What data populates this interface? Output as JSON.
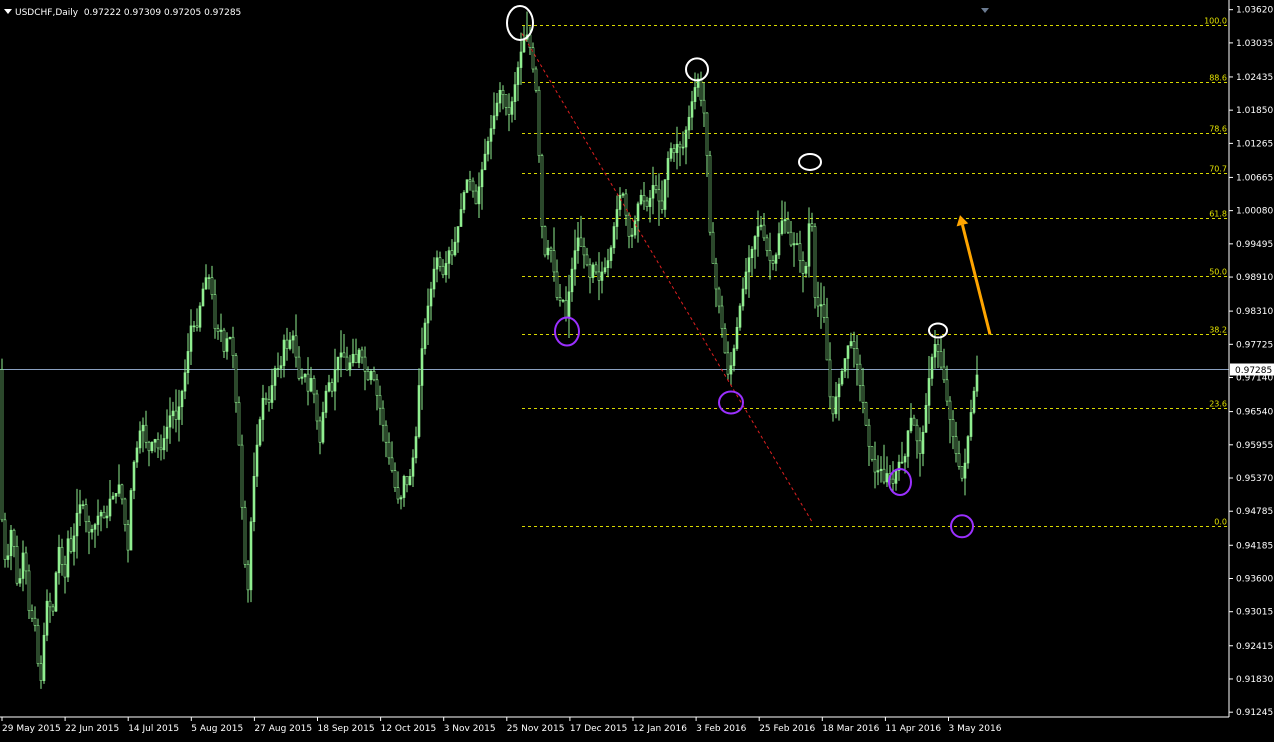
{
  "header": {
    "symbol": "USDCHF,Daily",
    "ohlc": "0.97222 0.97309 0.97205 0.97285"
  },
  "colors": {
    "background": "#000000",
    "candle": "#90ee90",
    "fib_line": "#d8d800",
    "fib_label": "#e0e000",
    "trend_line": "#e02020",
    "arrow": "#ffa500",
    "high_marker": "#ffffff",
    "low_marker": "#9b30ff",
    "axis_text": "#ffffff",
    "price_line": "#8aa0c0"
  },
  "chart_data": {
    "type": "candlestick",
    "symbol": "USDCHF",
    "timeframe": "Daily",
    "x_labels": [
      "29 May 2015",
      "22 Jun 2015",
      "14 Jul 2015",
      "5 Aug 2015",
      "27 Aug 2015",
      "18 Sep 2015",
      "12 Oct 2015",
      "3 Nov 2015",
      "25 Nov 2015",
      "17 Dec 2015",
      "12 Jan 2016",
      "3 Feb 2016",
      "25 Feb 2016",
      "18 Mar 2016",
      "11 Apr 2016",
      "3 May 2016"
    ],
    "y_ticks": [
      "1.03620",
      "1.03035",
      "1.02435",
      "1.01850",
      "1.01265",
      "1.00665",
      "1.00080",
      "0.99495",
      "0.98910",
      "0.98310",
      "0.97725",
      "0.97140",
      "0.96540",
      "0.95955",
      "0.95370",
      "0.94785",
      "0.94185",
      "0.93600",
      "0.93015",
      "0.92415",
      "0.91830",
      "0.91245"
    ],
    "y_range": [
      0.9116,
      1.0372
    ],
    "current_price": "0.97285",
    "price_path": [
      [
        0,
        0.951
      ],
      [
        6,
        0.937
      ],
      [
        12,
        0.946
      ],
      [
        18,
        0.933
      ],
      [
        24,
        0.942
      ],
      [
        30,
        0.928
      ],
      [
        34,
        0.93
      ],
      [
        38,
        0.921
      ],
      [
        41,
        0.918
      ],
      [
        44,
        0.926
      ],
      [
        48,
        0.934
      ],
      [
        52,
        0.928
      ],
      [
        56,
        0.937
      ],
      [
        60,
        0.943
      ],
      [
        64,
        0.934
      ],
      [
        68,
        0.943
      ],
      [
        72,
        0.94
      ],
      [
        76,
        0.947
      ],
      [
        82,
        0.95
      ],
      [
        88,
        0.944
      ],
      [
        94,
        0.945
      ],
      [
        100,
        0.948
      ],
      [
        106,
        0.946
      ],
      [
        110,
        0.95
      ],
      [
        116,
        0.951
      ],
      [
        120,
        0.953
      ],
      [
        124,
        0.947
      ],
      [
        128,
        0.941
      ],
      [
        132,
        0.955
      ],
      [
        136,
        0.958
      ],
      [
        142,
        0.964
      ],
      [
        148,
        0.958
      ],
      [
        154,
        0.961
      ],
      [
        160,
        0.958
      ],
      [
        166,
        0.962
      ],
      [
        172,
        0.966
      ],
      [
        176,
        0.964
      ],
      [
        180,
        0.967
      ],
      [
        184,
        0.971
      ],
      [
        188,
        0.976
      ],
      [
        192,
        0.982
      ],
      [
        196,
        0.979
      ],
      [
        200,
        0.984
      ],
      [
        204,
        0.988
      ],
      [
        208,
        0.99
      ],
      [
        212,
        0.986
      ],
      [
        216,
        0.978
      ],
      [
        220,
        0.981
      ],
      [
        224,
        0.976
      ],
      [
        228,
        0.979
      ],
      [
        232,
        0.978
      ],
      [
        236,
        0.967
      ],
      [
        240,
        0.957
      ],
      [
        244,
        0.94
      ],
      [
        248,
        0.934
      ],
      [
        252,
        0.95
      ],
      [
        256,
        0.958
      ],
      [
        260,
        0.964
      ],
      [
        264,
        0.969
      ],
      [
        268,
        0.966
      ],
      [
        272,
        0.97
      ],
      [
        276,
        0.974
      ],
      [
        280,
        0.972
      ],
      [
        284,
        0.978
      ],
      [
        288,
        0.976
      ],
      [
        292,
        0.98
      ],
      [
        296,
        0.975
      ],
      [
        300,
        0.97
      ],
      [
        304,
        0.973
      ],
      [
        308,
        0.969
      ],
      [
        312,
        0.972
      ],
      [
        316,
        0.965
      ],
      [
        320,
        0.96
      ],
      [
        324,
        0.967
      ],
      [
        328,
        0.971
      ],
      [
        332,
        0.969
      ],
      [
        336,
        0.974
      ],
      [
        340,
        0.976
      ],
      [
        344,
        0.975
      ],
      [
        348,
        0.972
      ],
      [
        352,
        0.976
      ],
      [
        356,
        0.974
      ],
      [
        360,
        0.977
      ],
      [
        364,
        0.973
      ],
      [
        368,
        0.971
      ],
      [
        372,
        0.973
      ],
      [
        376,
        0.969
      ],
      [
        380,
        0.966
      ],
      [
        384,
        0.962
      ],
      [
        388,
        0.958
      ],
      [
        392,
        0.955
      ],
      [
        396,
        0.951
      ],
      [
        400,
        0.949
      ],
      [
        404,
        0.954
      ],
      [
        408,
        0.952
      ],
      [
        412,
        0.956
      ],
      [
        416,
        0.961
      ],
      [
        420,
        0.973
      ],
      [
        424,
        0.98
      ],
      [
        428,
        0.984
      ],
      [
        432,
        0.988
      ],
      [
        436,
        0.993
      ],
      [
        440,
        0.991
      ],
      [
        444,
        0.989
      ],
      [
        448,
        0.994
      ],
      [
        452,
        0.993
      ],
      [
        456,
        0.996
      ],
      [
        460,
        1.0
      ],
      [
        464,
        1.004
      ],
      [
        468,
        1.007
      ],
      [
        472,
        1.005
      ],
      [
        476,
        1.002
      ],
      [
        480,
        1.006
      ],
      [
        484,
        1.01
      ],
      [
        488,
        1.013
      ],
      [
        492,
        1.016
      ],
      [
        496,
        1.019
      ],
      [
        500,
        1.022
      ],
      [
        504,
        1.021
      ],
      [
        508,
        1.017
      ],
      [
        512,
        1.02
      ],
      [
        516,
        1.024
      ],
      [
        520,
        1.028
      ],
      [
        524,
        1.031
      ],
      [
        528,
        1.032
      ],
      [
        532,
        1.027
      ],
      [
        536,
        1.022
      ],
      [
        538,
        1.015
      ],
      [
        540,
        1.006
      ],
      [
        542,
        0.998
      ],
      [
        545,
        0.993
      ],
      [
        550,
        0.995
      ],
      [
        554,
        0.99
      ],
      [
        558,
        0.984
      ],
      [
        562,
        0.986
      ],
      [
        566,
        0.982
      ],
      [
        570,
        0.988
      ],
      [
        574,
        0.993
      ],
      [
        578,
        0.996
      ],
      [
        582,
        0.994
      ],
      [
        586,
        0.992
      ],
      [
        590,
        0.989
      ],
      [
        594,
        0.992
      ],
      [
        598,
        0.988
      ],
      [
        602,
        0.99
      ],
      [
        606,
        0.991
      ],
      [
        610,
        0.993
      ],
      [
        614,
        0.998
      ],
      [
        618,
        1.002
      ],
      [
        622,
        1.005
      ],
      [
        626,
        1.0
      ],
      [
        630,
        0.995
      ],
      [
        634,
        0.998
      ],
      [
        638,
        1.002
      ],
      [
        642,
        1.004
      ],
      [
        646,
        1.001
      ],
      [
        650,
        1.003
      ],
      [
        654,
        1.006
      ],
      [
        658,
        1.003
      ],
      [
        662,
        1.001
      ],
      [
        666,
        1.008
      ],
      [
        670,
        1.012
      ],
      [
        674,
        1.011
      ],
      [
        678,
        1.013
      ],
      [
        682,
        1.011
      ],
      [
        686,
        1.015
      ],
      [
        690,
        1.018
      ],
      [
        694,
        1.022
      ],
      [
        698,
        1.024
      ],
      [
        702,
        1.019
      ],
      [
        706,
        1.017
      ],
      [
        708,
        1.004
      ],
      [
        710,
        0.997
      ],
      [
        712,
        0.99
      ],
      [
        714,
        0.993
      ],
      [
        716,
        0.987
      ],
      [
        720,
        0.983
      ],
      [
        724,
        0.977
      ],
      [
        728,
        0.972
      ],
      [
        732,
        0.974
      ],
      [
        736,
        0.979
      ],
      [
        740,
        0.984
      ],
      [
        744,
        0.988
      ],
      [
        748,
        0.992
      ],
      [
        752,
        0.994
      ],
      [
        756,
        0.997
      ],
      [
        760,
        0.999
      ],
      [
        764,
        0.996
      ],
      [
        768,
        0.993
      ],
      [
        772,
        0.991
      ],
      [
        776,
        0.993
      ],
      [
        780,
        0.998
      ],
      [
        784,
        1.0
      ],
      [
        788,
        0.997
      ],
      [
        792,
        0.994
      ],
      [
        796,
        0.996
      ],
      [
        800,
        0.992
      ],
      [
        804,
        0.989
      ],
      [
        808,
        0.993
      ],
      [
        810,
        1.004
      ],
      [
        812,
        0.998
      ],
      [
        814,
        0.988
      ],
      [
        816,
        0.983
      ],
      [
        820,
        0.985
      ],
      [
        824,
        0.982
      ],
      [
        828,
        0.972
      ],
      [
        832,
        0.964
      ],
      [
        836,
        0.968
      ],
      [
        840,
        0.971
      ],
      [
        844,
        0.974
      ],
      [
        848,
        0.977
      ],
      [
        852,
        0.978
      ],
      [
        856,
        0.975
      ],
      [
        860,
        0.97
      ],
      [
        864,
        0.966
      ],
      [
        868,
        0.96
      ],
      [
        872,
        0.957
      ],
      [
        876,
        0.954
      ],
      [
        880,
        0.956
      ],
      [
        884,
        0.953
      ],
      [
        888,
        0.955
      ],
      [
        892,
        0.952
      ],
      [
        896,
        0.955
      ],
      [
        900,
        0.957
      ],
      [
        904,
        0.956
      ],
      [
        908,
        0.962
      ],
      [
        912,
        0.965
      ],
      [
        916,
        0.961
      ],
      [
        920,
        0.958
      ],
      [
        924,
        0.963
      ],
      [
        928,
        0.97
      ],
      [
        932,
        0.975
      ],
      [
        936,
        0.978
      ],
      [
        940,
        0.974
      ],
      [
        944,
        0.971
      ],
      [
        948,
        0.966
      ],
      [
        952,
        0.962
      ],
      [
        956,
        0.958
      ],
      [
        960,
        0.955
      ],
      [
        963,
        0.953
      ],
      [
        966,
        0.958
      ],
      [
        970,
        0.964
      ],
      [
        974,
        0.969
      ],
      [
        978,
        0.9728
      ]
    ],
    "fibonacci": {
      "levels": [
        {
          "label": "100.0",
          "price": 1.0335
        },
        {
          "label": "88.6",
          "price": 1.0235
        },
        {
          "label": "78.6",
          "price": 1.0145
        },
        {
          "label": "70.7",
          "price": 1.0075
        },
        {
          "label": "61.8",
          "price": 0.9995
        },
        {
          "label": "50.0",
          "price": 0.9893
        },
        {
          "label": "38.2",
          "price": 0.979
        },
        {
          "label": "23.6",
          "price": 0.966
        },
        {
          "label": "0.0",
          "price": 0.9452
        }
      ]
    },
    "high_markers": [
      {
        "x": 520,
        "price": 1.0335
      },
      {
        "x": 697,
        "price": 1.0255
      },
      {
        "x": 810,
        "price": 1.0092
      },
      {
        "x": 938,
        "price": 0.9795
      }
    ],
    "low_markers": [
      {
        "x": 567,
        "price": 0.9795
      },
      {
        "x": 731,
        "price": 0.967
      },
      {
        "x": 900,
        "price": 0.953
      },
      {
        "x": 962,
        "price": 0.9452
      }
    ],
    "trend_line": {
      "x1": 522,
      "p1": 1.032,
      "x2": 812,
      "p2": 0.946
    },
    "arrow": {
      "x1": 990,
      "p1": 0.979,
      "x2": 960,
      "p2": 1.0
    }
  }
}
